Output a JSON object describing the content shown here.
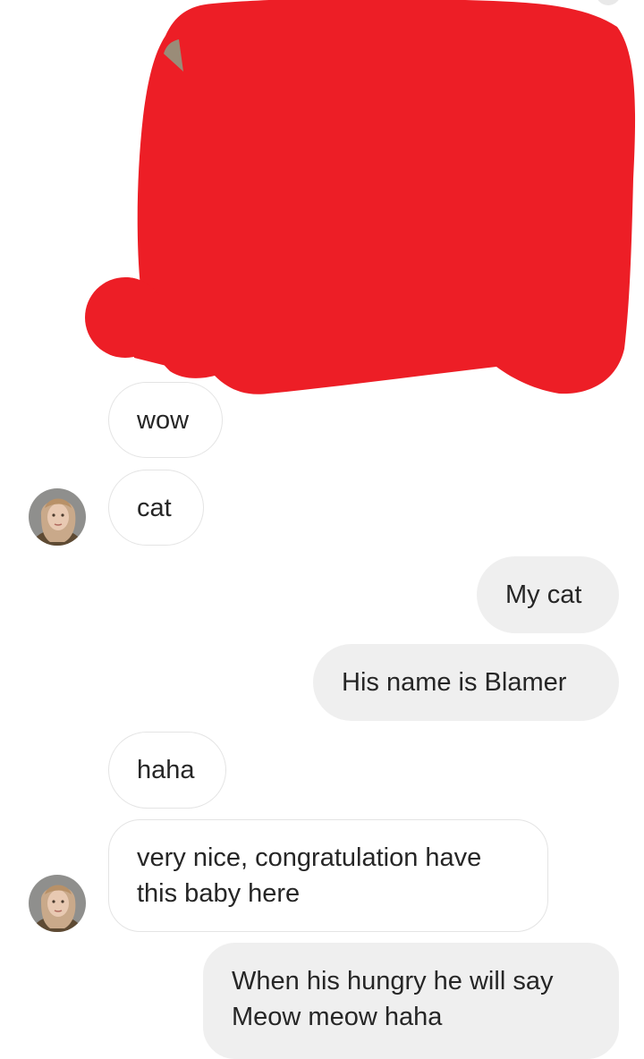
{
  "thread": {
    "messages": [
      {
        "id": "m1",
        "side": "incoming",
        "text": "wow"
      },
      {
        "id": "m2",
        "side": "incoming",
        "text": "cat",
        "avatar": true
      },
      {
        "id": "m3",
        "side": "outgoing",
        "text": "My cat"
      },
      {
        "id": "m4",
        "side": "outgoing",
        "text": "His name is Blamer"
      },
      {
        "id": "m5",
        "side": "incoming",
        "text": "haha"
      },
      {
        "id": "m6",
        "side": "incoming",
        "text": "very nice, congratulation have this baby here",
        "avatar": true
      },
      {
        "id": "m7",
        "side": "outgoing",
        "text": "When his hungry he will say Meow meow haha"
      }
    ],
    "redaction_color": "#ED1E26",
    "incoming_bubble_color": "#FFFFFF",
    "outgoing_bubble_color": "#EFEFEF",
    "avatar_icon": "contact-avatar-icon"
  }
}
